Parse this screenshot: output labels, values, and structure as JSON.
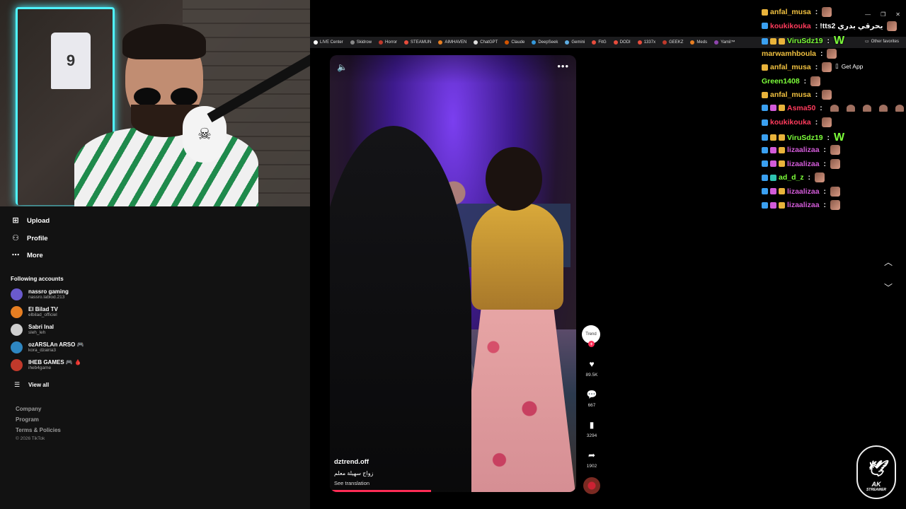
{
  "webcam": {
    "jersey_number": "9"
  },
  "bookmarks": [
    {
      "label": "LIVE Center",
      "color": "#ffffff"
    },
    {
      "label": "Skidrow",
      "color": "#888888"
    },
    {
      "label": "Horror",
      "color": "#c0392b"
    },
    {
      "label": "STEAMUN",
      "color": "#e74c3c"
    },
    {
      "label": "AIMHAVEN",
      "color": "#e67e22"
    },
    {
      "label": "ChatGPT",
      "color": "#dddddd"
    },
    {
      "label": "Claude",
      "color": "#d35400"
    },
    {
      "label": "DeepSeek",
      "color": "#3498db"
    },
    {
      "label": "Gemini",
      "color": "#5dade2"
    },
    {
      "label": "FitG",
      "color": "#e74c3c"
    },
    {
      "label": "DODI",
      "color": "#e74c3c"
    },
    {
      "label": "1337x",
      "color": "#e74c3c"
    },
    {
      "label": "GEEKZ",
      "color": "#c0392b"
    },
    {
      "label": "Meds",
      "color": "#e67e22"
    },
    {
      "label": "Yamil™",
      "color": "#8e44ad"
    }
  ],
  "bookmarks_other": "Other favorites",
  "nav": {
    "items": [
      {
        "label": "Upload",
        "icon": "plus-square-icon"
      },
      {
        "label": "Profile",
        "icon": "person-icon"
      },
      {
        "label": "More",
        "icon": "ellipsis-icon"
      }
    ],
    "following_title": "Following accounts",
    "accounts": [
      {
        "name": "nassro gaming",
        "handle": "nassro.lablod.213",
        "color": "#6a5acd"
      },
      {
        "name": "El Bilad TV",
        "handle": "elbilad_officiel",
        "color": "#e67e22"
      },
      {
        "name": "Sabri Inal",
        "handle": "sleh_leh",
        "color": "#cfcfcf"
      },
      {
        "name": "ozARSLAn ARSO 🎮",
        "handle": "kora_dzairia3",
        "color": "#2e86c1"
      },
      {
        "name": "IHEB GAMES 🎮 🩸",
        "handle": "iheb4game",
        "color": "#c0392b"
      }
    ],
    "view_all": "View all",
    "footer": [
      "Company",
      "Program",
      "Terms & Policies"
    ],
    "copyright": "© 2026 TikTok"
  },
  "video": {
    "author": "dztrend.off",
    "description": "زواج سهيلة معلم",
    "translate": "See translation",
    "progress_fraction": 0.41
  },
  "rail": {
    "avatar_text": "Trend",
    "likes": "89.5K",
    "comments": "667",
    "saves": "3294",
    "shares": "1902"
  },
  "chat": {
    "get_app": "Get App",
    "messages": [
      {
        "user": "anfal_musa",
        "color": "#f0c040",
        "badges": [
          "gold"
        ],
        "text": "",
        "emote": "box"
      },
      {
        "user": "koukikouka",
        "color": "#ff3b5c",
        "badges": [
          "blue"
        ],
        "text": "!tts2 يحرقي بدري",
        "emote": "box"
      },
      {
        "user": "ViruSdz19",
        "color": "#7dff3a",
        "badges": [
          "blue",
          "gold",
          "gold"
        ],
        "text": "",
        "emote": "W"
      },
      {
        "user": "marwamhboula",
        "color": "#f0c040",
        "badges": [],
        "text": "",
        "emote": "box"
      },
      {
        "user": "anfal_musa",
        "color": "#f0c040",
        "badges": [
          "gold"
        ],
        "text": "",
        "emote": "box"
      },
      {
        "user": "Green1408",
        "color": "#7dff3a",
        "badges": [],
        "text": "",
        "emote": "box"
      },
      {
        "user": "anfal_musa",
        "color": "#f0c040",
        "badges": [
          "gold"
        ],
        "text": "",
        "emote": "box"
      },
      {
        "user": "Asma50",
        "color": "#ff3b5c",
        "badges": [
          "blue",
          "pink",
          "gold"
        ],
        "text": "",
        "emote": "multi"
      },
      {
        "user": "koukikouka",
        "color": "#ff3b5c",
        "badges": [
          "blue"
        ],
        "text": "",
        "emote": "box"
      },
      {
        "user": "ViruSdz19",
        "color": "#7dff3a",
        "badges": [
          "blue",
          "gold",
          "gold"
        ],
        "text": "",
        "emote": "W"
      },
      {
        "user": "lizaalizaa",
        "color": "#d25bd8",
        "badges": [
          "blue",
          "pink",
          "gold"
        ],
        "text": "",
        "emote": "box"
      },
      {
        "user": "lizaalizaa",
        "color": "#d25bd8",
        "badges": [
          "blue",
          "pink",
          "gold"
        ],
        "text": "",
        "emote": "box"
      },
      {
        "user": "ad_d_z",
        "color": "#7dff3a",
        "badges": [
          "blue",
          "teal"
        ],
        "text": "",
        "emote": "box"
      },
      {
        "user": "lizaalizaa",
        "color": "#d25bd8",
        "badges": [
          "blue",
          "pink",
          "gold"
        ],
        "text": "",
        "emote": "box"
      },
      {
        "user": "lizaalizaa",
        "color": "#d25bd8",
        "badges": [
          "blue",
          "pink",
          "gold"
        ],
        "text": "",
        "emote": "box"
      }
    ]
  },
  "logo": {
    "text": "AK",
    "sub": "STREAMER"
  }
}
